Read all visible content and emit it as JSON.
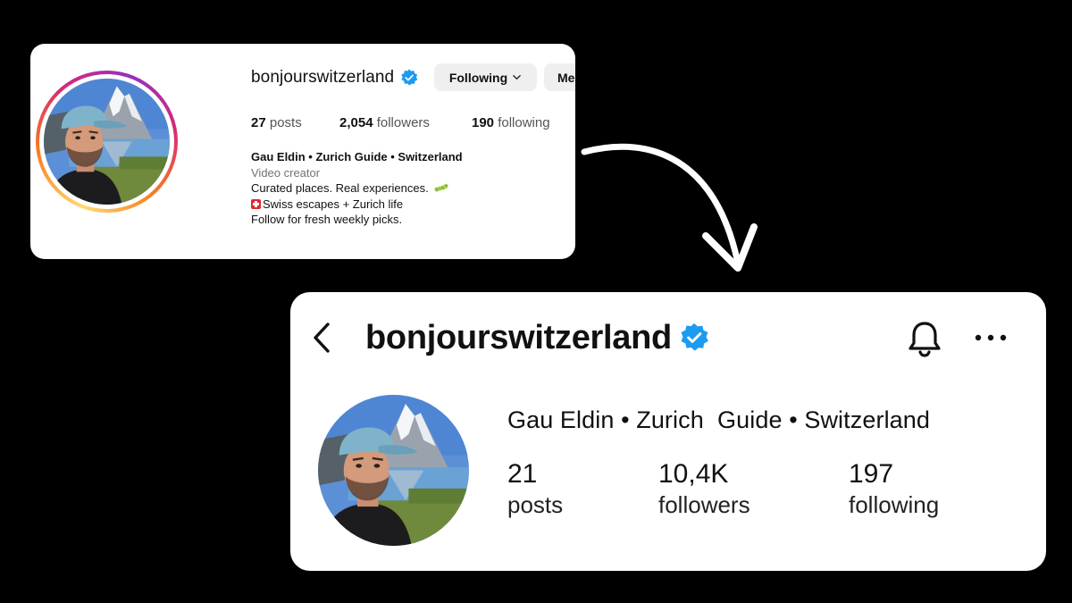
{
  "colors": {
    "background": "#000000",
    "card": "#ffffff",
    "verified_badge": "#1d9bf0",
    "button_bg": "#efefef",
    "ring_gradient": [
      "#feda75",
      "#fa7e1e",
      "#d62976",
      "#962fbf"
    ]
  },
  "desktop_profile": {
    "username": "bonjourswitzerland",
    "verified_icon": "verified-badge-icon",
    "following_button_label": "Following",
    "following_button_icon": "chevron-down-icon",
    "message_button_label": "Me",
    "stats": [
      {
        "value": "27",
        "label": "posts"
      },
      {
        "value": "2,054",
        "label": "followers"
      },
      {
        "value": "190",
        "label": "following"
      }
    ],
    "bio": {
      "name": "Gau Eldin • Zurich Guide • Switzerland",
      "category": "Video creator",
      "line1": "Curated places. Real experiences.",
      "line1_emoji": "caterpillar-icon",
      "line2": "Swiss escapes + Zurich life",
      "line2_emoji": "swiss-flag-icon",
      "line3": "Follow for fresh weekly picks."
    }
  },
  "mobile_profile": {
    "back_icon": "chevron-left-icon",
    "username": "bonjourswitzerland",
    "verified_icon": "verified-badge-icon",
    "bell_icon": "bell-icon",
    "more_icon": "more-dots-icon",
    "display_name": "Gau Eldin • Zurich  Guide • Switzerland",
    "stats": [
      {
        "value": "21",
        "label": "posts"
      },
      {
        "value": "10,4K",
        "label": "followers"
      },
      {
        "value": "197",
        "label": "following"
      }
    ]
  }
}
